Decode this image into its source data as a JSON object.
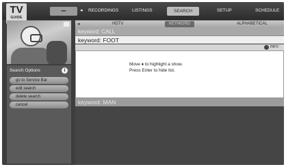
{
  "logo": {
    "line1": "TV",
    "line2": "GUIDE"
  },
  "nav": {
    "back_label": "▪▪▪",
    "items": [
      "RECORDINGS",
      "LISTINGS",
      "SEARCH",
      "SETUP",
      "SCHEDULE"
    ],
    "selected": "SEARCH"
  },
  "subtabs": {
    "items": [
      "HDTV",
      "KEYWORD",
      "ALPHABETICAL"
    ],
    "selected": "KEYWORD"
  },
  "sidebar": {
    "header": "Search Options",
    "buttons": [
      "go to Service Bar",
      "edit search",
      "delete search",
      "cancel"
    ]
  },
  "keywords": {
    "k1": "keyword: CALL",
    "k2": "keyword: FOOT",
    "k3": "keyword: MAN"
  },
  "info_label": "INFO",
  "panel": {
    "line1": "Move ♦ to highlight a show.",
    "line2": "Press Enter to hide list."
  }
}
